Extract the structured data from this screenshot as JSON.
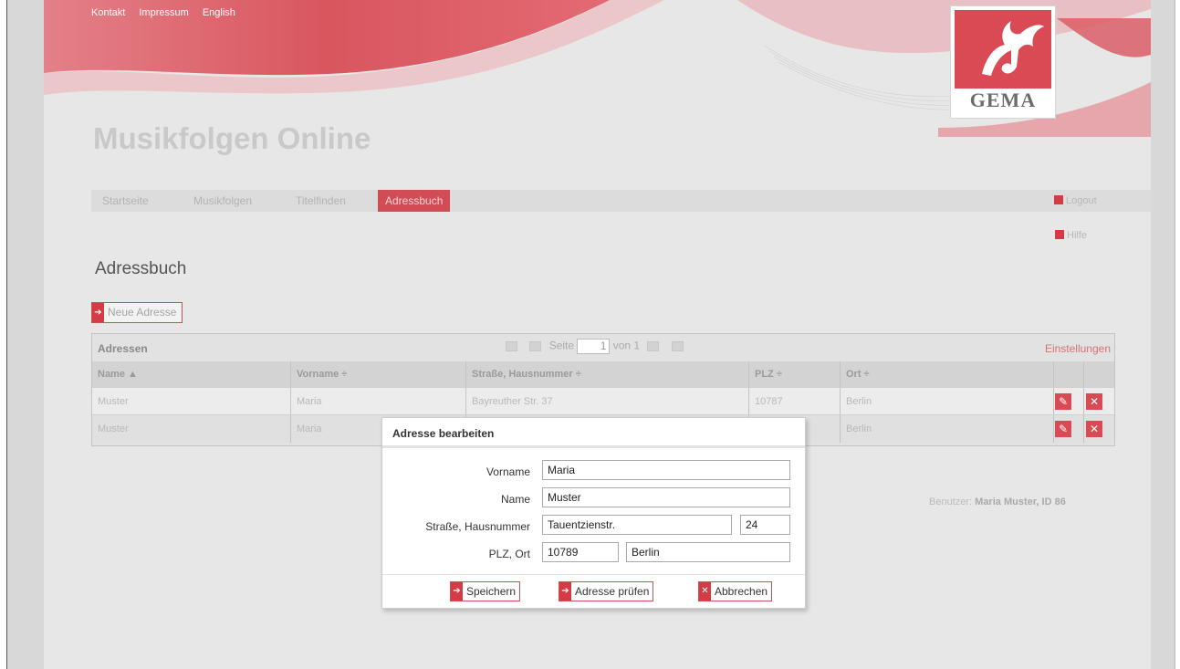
{
  "top_links": [
    "Kontakt",
    "Impressum",
    "English"
  ],
  "logo_text": "GEMA",
  "app_title": "Musikfolgen Online",
  "tabs": [
    {
      "label": "Startseite",
      "active": false
    },
    {
      "label": "Musikfolgen",
      "active": false
    },
    {
      "label": "Titelfinden",
      "active": false
    },
    {
      "label": "Adressbuch",
      "active": true
    }
  ],
  "side_links": {
    "logout": "Logout",
    "help": "Hilfe"
  },
  "page_heading": "Adressbuch",
  "new_address_button": "Neue Adresse",
  "grid": {
    "title": "Adressen",
    "pager": {
      "page_label": "Seite",
      "current_page": "1",
      "of_label": "von 1"
    },
    "settings_link": "Einstellungen",
    "columns": [
      "Name ▲",
      "Vorname ÷",
      "Straße, Hausnummer ÷",
      "PLZ ÷",
      "Ort ÷"
    ],
    "rows": [
      {
        "name": "Muster",
        "vorname": "Maria",
        "strasse": "Bayreuther Str. 37",
        "plz": "10787",
        "ort": "Berlin"
      },
      {
        "name": "Muster",
        "vorname": "Maria",
        "strasse": "",
        "plz": "",
        "ort": "Berlin"
      }
    ]
  },
  "user_info": {
    "label": "Benutzer:",
    "value": "Maria Muster, ID 86"
  },
  "dialog": {
    "title": "Adresse bearbeiten",
    "labels": {
      "vorname": "Vorname",
      "name": "Name",
      "strasse": "Straße, Hausnummer",
      "plz_ort": "PLZ, Ort"
    },
    "values": {
      "vorname": "Maria",
      "name": "Muster",
      "strasse": "Tauentzienstr.",
      "hausnummer": "24",
      "plz": "10789",
      "ort": "Berlin"
    },
    "buttons": {
      "save": "Speichern",
      "check": "Adresse prüfen",
      "cancel": "Abbrechen"
    }
  },
  "colors": {
    "accent": "#d43b45",
    "page_bg": "#e7e7e7",
    "tab_active": "#d14c54"
  },
  "icons": [
    "edit-icon",
    "delete-icon",
    "arrow-right-icon",
    "close-icon",
    "first-page-icon",
    "prev-page-icon",
    "next-page-icon",
    "last-page-icon"
  ]
}
